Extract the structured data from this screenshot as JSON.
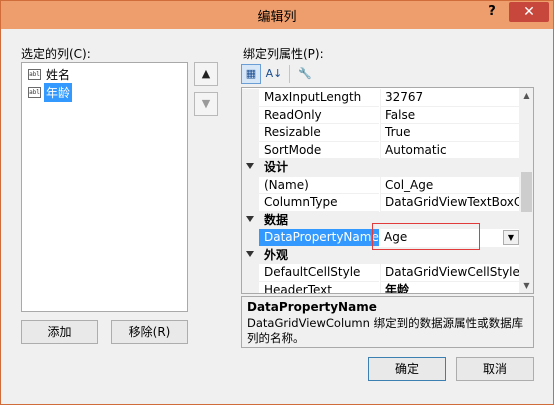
{
  "window": {
    "title": "编辑列",
    "help": "?",
    "close": "✕"
  },
  "left": {
    "label": "选定的列(C):",
    "columns": [
      {
        "icon": "abl",
        "label": "姓名",
        "selected": false
      },
      {
        "icon": "abl",
        "label": "年龄",
        "selected": true
      }
    ],
    "move_up": "▲",
    "move_down": "▼",
    "add_label": "添加",
    "remove_label": "移除(R)"
  },
  "right": {
    "label": "绑定列属性(P):",
    "toolbar": {
      "categorized": "▦",
      "alphabetical": "A↓",
      "property_pages": "🔧"
    },
    "rows": [
      {
        "kind": "prop",
        "name": "MaxInputLength",
        "value": "32767"
      },
      {
        "kind": "prop",
        "name": "ReadOnly",
        "value": "False"
      },
      {
        "kind": "prop",
        "name": "Resizable",
        "value": "True"
      },
      {
        "kind": "prop",
        "name": "SortMode",
        "value": "Automatic"
      },
      {
        "kind": "cat",
        "name": "设计"
      },
      {
        "kind": "prop",
        "name": "(Name)",
        "value": "Col_Age"
      },
      {
        "kind": "prop",
        "name": "ColumnType",
        "value": "DataGridViewTextBoxColu"
      },
      {
        "kind": "cat",
        "name": "数据"
      },
      {
        "kind": "edit",
        "name": "DataPropertyName",
        "value": "Age"
      },
      {
        "kind": "cat",
        "name": "外观"
      },
      {
        "kind": "prop",
        "name": "DefaultCellStyle",
        "value": "DataGridViewCellStyle { }"
      },
      {
        "kind": "prop",
        "name": "HeaderText",
        "value": "年龄",
        "bold": true
      }
    ],
    "description": {
      "title": "DataPropertyName",
      "body": "DataGridViewColumn 绑定到的数据源属性或数据库列的名称。"
    }
  },
  "footer": {
    "ok_label": "确定",
    "cancel_label": "取消"
  },
  "colors": {
    "titlebar": "#ee9e6c",
    "close": "#c7473c",
    "selection": "#3399ff",
    "highlight_box": "#e23b3b"
  }
}
